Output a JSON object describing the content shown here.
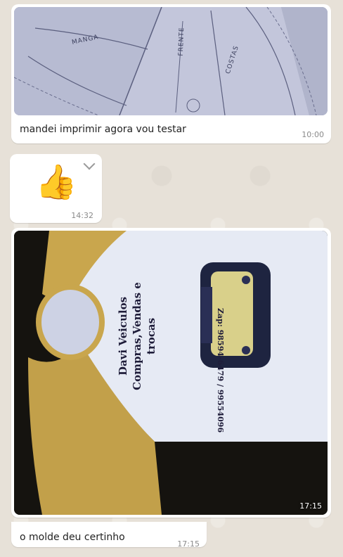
{
  "messages": [
    {
      "type": "image",
      "caption": "mandei imprimir agora vou testar",
      "time": "10:00",
      "photo_labels": [
        "MANGA",
        "FRENTE",
        "COSTAS"
      ]
    },
    {
      "type": "emoji",
      "emoji": "👍",
      "time": "14:32",
      "menu_icon": "chevron-down-icon"
    },
    {
      "type": "image",
      "time": "17:15",
      "shirt_print": {
        "line1": "Davi Veiculos",
        "line2": "Compras,Vendas e",
        "line3": "trocas",
        "phone": "Zap: 98594-6479 / 99554096"
      }
    },
    {
      "type": "text",
      "text": "o molde deu certinho",
      "time": "17:15"
    }
  ],
  "colors": {
    "bubble": "#ffffff",
    "wallpaper": "#e7e1d8",
    "shirt_white": "#e8ecf4",
    "shirt_sleeve": "#c9a64d",
    "print_text": "#1f1d3a"
  }
}
